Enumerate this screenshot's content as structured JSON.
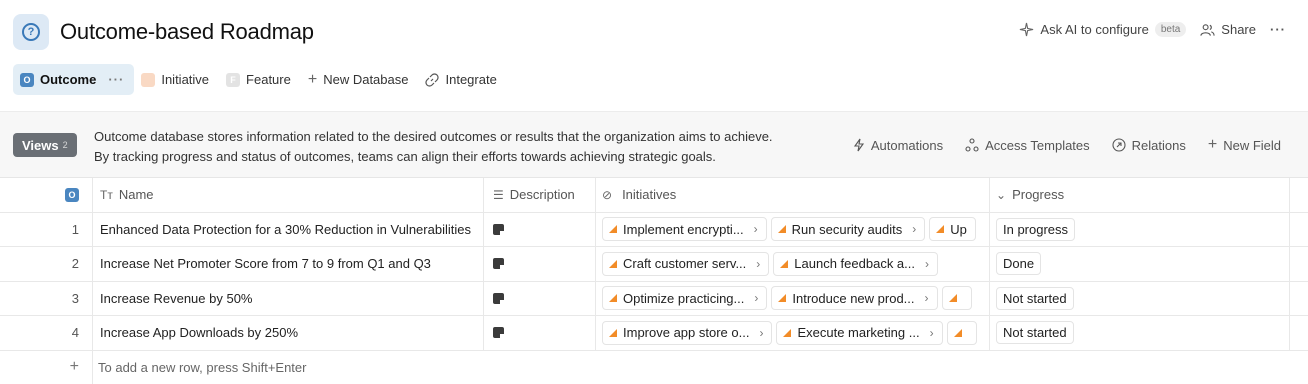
{
  "header": {
    "title": "Outcome-based Roadmap",
    "ask_ai_label": "Ask AI to configure",
    "beta_label": "beta",
    "share_label": "Share",
    "more_label": "···"
  },
  "tabs": [
    {
      "label": "Outcome",
      "badge": "O",
      "badge_color": "#4a86c0",
      "active": true
    },
    {
      "label": "Initiative",
      "badge": "",
      "badge_color": "#f9d9c4"
    },
    {
      "label": "Feature",
      "badge": "F",
      "badge_color": "#e3e3e3"
    },
    {
      "label": "New Database"
    },
    {
      "label": "Integrate"
    }
  ],
  "infobar": {
    "views_label": "Views",
    "views_count": "2",
    "description_line1": "Outcome database stores information related to the desired outcomes or results that the organization aims to achieve.",
    "description_line2": "By tracking progress and status of outcomes, teams can align their efforts towards achieving strategic goals.",
    "actions": [
      "Automations",
      "Access Templates",
      "Relations",
      "New Field"
    ]
  },
  "table": {
    "columns": {
      "index_badge": "O",
      "name": "Name",
      "description": "Description",
      "initiatives": "Initiatives",
      "progress": "Progress"
    },
    "rows": [
      {
        "index": "1",
        "name": "Enhanced Data Protection for a 30% Reduction in Vulnerabilities",
        "initiatives": [
          "Implement encrypti...",
          "Run security audits",
          "Up"
        ],
        "progress": "In progress"
      },
      {
        "index": "2",
        "name": "Increase Net Promoter Score from 7 to 9 from Q1 and Q3",
        "initiatives": [
          "Craft customer serv...",
          "Launch feedback a..."
        ],
        "progress": "Done"
      },
      {
        "index": "3",
        "name": "Increase Revenue by 50%",
        "initiatives": [
          "Optimize practicing...",
          "Introduce new prod...",
          ""
        ],
        "progress": "Not started"
      },
      {
        "index": "4",
        "name": "Increase App Downloads by 250%",
        "initiatives": [
          "Improve app store o...",
          "Execute marketing ...",
          ""
        ],
        "progress": "Not started"
      }
    ],
    "add_row_hint": "To add a new row, press Shift+Enter",
    "add_row_symbol": "+"
  },
  "colors": {
    "accent": "#4a86c0",
    "initiative_icon": "#f28c28",
    "views_bg": "#6a6f75"
  }
}
